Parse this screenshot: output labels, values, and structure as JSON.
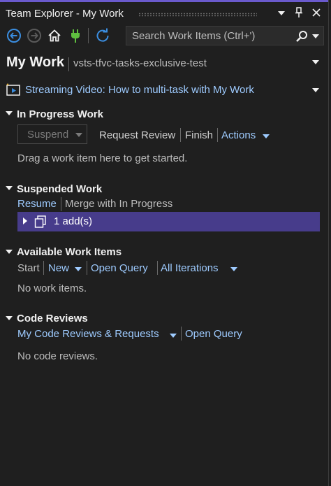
{
  "window": {
    "title": "Team Explorer - My Work"
  },
  "toolbar": {
    "search_placeholder": "Search Work Items (Ctrl+')"
  },
  "header": {
    "page_title": "My Work",
    "project": "vsts-tfvc-tasks-exclusive-test"
  },
  "video_link": "Streaming Video: How to multi-task with My Work",
  "sections": {
    "in_progress": {
      "title": "In Progress Work",
      "suspend_label": "Suspend",
      "request_review": "Request Review",
      "finish": "Finish",
      "actions": "Actions",
      "empty_hint": "Drag a work item here to get started."
    },
    "suspended": {
      "title": "Suspended Work",
      "resume": "Resume",
      "merge": "Merge with In Progress",
      "item_label": "1 add(s)"
    },
    "available": {
      "title": "Available Work Items",
      "start": "Start",
      "new": "New",
      "open_query": "Open Query",
      "all_iterations": "All Iterations",
      "empty_text": "No work items."
    },
    "code_reviews": {
      "title": "Code Reviews",
      "my_reviews": "My Code Reviews & Requests",
      "open_query": "Open Query",
      "empty_text": "No code reviews."
    }
  },
  "colors": {
    "background": "#1f1f1f",
    "link": "#9ecbff",
    "selection": "#473c8b",
    "accent": "#6a5acd",
    "nav_blue": "#3b8ee0",
    "plug_green": "#5fbf3f"
  }
}
